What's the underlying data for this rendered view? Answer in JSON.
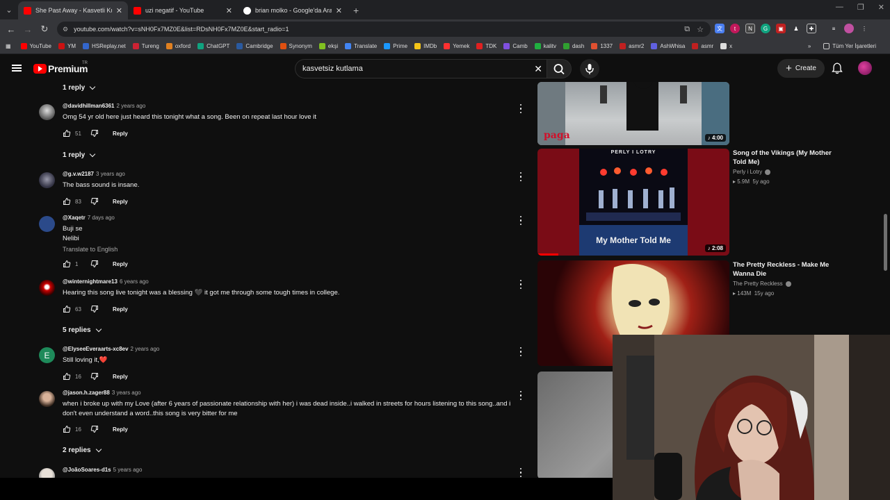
{
  "browser": {
    "tabs": [
      {
        "title": "She Past Away - Kasvetli Kutlam",
        "color": "#ff0000",
        "active": true
      },
      {
        "title": "uzi negatif - YouTube",
        "color": "#ff0000",
        "active": false
      },
      {
        "title": "brian molko - Google'da Ara",
        "color": "#4285f4",
        "active": false
      }
    ],
    "url": "youtube.com/watch?v=sNH0Fx7MZ0E&list=RDsNH0Fx7MZ0E&start_radio=1",
    "bookmarks": [
      "YouTube",
      "YM",
      "HSReplay.net",
      "Tureng",
      "oxford",
      "ChatGPT",
      "Cambridge",
      "Synonym",
      "ekşi",
      "Translate",
      "Prime",
      "IMDb",
      "Yemek",
      "TDK",
      "Camb",
      "kalitv",
      "dash",
      "1337",
      "asmr2",
      "AshWhisa",
      "asmr",
      "x"
    ],
    "bookmark_colors": [
      "#ff0000",
      "#cc1111",
      "#3366cc",
      "#cc2233",
      "#e08020",
      "#10a37f",
      "#2a5aa0",
      "#e05010",
      "#80c020",
      "#4285f4",
      "#1a98ff",
      "#f5c518",
      "#ff3030",
      "#e02020",
      "#8050e0",
      "#20b040",
      "#30a030",
      "#e05030",
      "#c02020",
      "#6060e0",
      "#c02020",
      "#dddddd"
    ],
    "bookmarks_all": "Tüm Yer İşaretleri"
  },
  "youtube": {
    "brand": "Premium",
    "region": "TR",
    "search_query": "kasvetsiz kutlama",
    "create_label": "Create"
  },
  "comments": {
    "reply_toggles": [
      "1 reply",
      "1 reply",
      "5 replies",
      "2 replies"
    ],
    "items": [
      {
        "author": "@davidhillman6361",
        "time": "2 years ago",
        "text": "Omg 54 yr old here just heard this tonight what a song. Been on repeat last hour love it",
        "likes": "51",
        "reply": "Reply"
      },
      {
        "author": "@g.v.w2187",
        "time": "3 years ago",
        "text": "The bass sound is insane.",
        "likes": "83",
        "reply": "Reply"
      },
      {
        "author": "@Xaqetr",
        "time": "7 days ago",
        "text_line1": "Buji se",
        "text_line2": "Nelibi",
        "translate": "Translate to English",
        "likes": "1",
        "reply": "Reply"
      },
      {
        "author": "@winternightmare13",
        "time": "6 years ago",
        "text": "Hearing this song live tonight was a blessing 🖤 it got me through some tough times in college.",
        "likes": "63",
        "reply": "Reply"
      },
      {
        "author": "@ElyseeEveraarts-xc8ev",
        "time": "2 years ago",
        "text": "Still loving it,❤️",
        "likes": "16",
        "reply": "Reply",
        "avatar_letter": "E"
      },
      {
        "author": "@jason.h.zager88",
        "time": "3 years ago",
        "text": "when i broke up with my Love (after 6 years of passionate relationship with her) i was dead inside..i walked in streets for hours listening to this song..and i don't even understand a word..this song is very bitter for me",
        "likes": "16",
        "reply": "Reply"
      },
      {
        "author": "@JoãoSoares-d1s",
        "time": "5 years ago"
      }
    ]
  },
  "sidebar_videos": [
    {
      "duration": "4:00",
      "thumb_text": "paga"
    },
    {
      "title": "Song of the Vikings (My Mother Told Me)",
      "channel": "Perly i Lotry",
      "views": "5.9M",
      "age": "5y ago",
      "duration": "2:08",
      "thumb_top": "PERLY I LOTRY",
      "thumb_caption": "My Mother Told Me"
    },
    {
      "title": "The Pretty Reckless - Make Me Wanna Die",
      "channel": "The Pretty Reckless",
      "views": "143M",
      "age": "15y ago"
    },
    {}
  ]
}
